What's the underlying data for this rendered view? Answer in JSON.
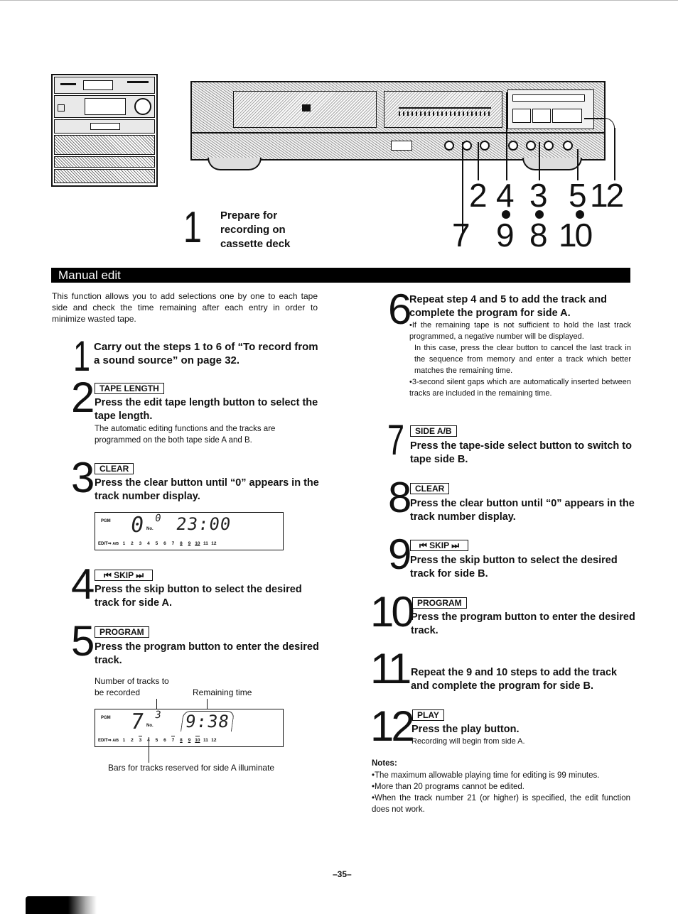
{
  "illustration": {
    "prepare_step": {
      "number": "1",
      "text": "Prepare for recording on cassette deck"
    },
    "callouts_top": [
      "2",
      "4",
      "3",
      "5",
      "12"
    ],
    "callouts_bottom": [
      "7",
      "9",
      "8",
      "10"
    ]
  },
  "section": {
    "title": "Manual edit"
  },
  "intro": "This function allows you to add selections one by one to each tape side and check the time remaining after each entry in order to minimize wasted tape.",
  "steps": [
    {
      "number": "1",
      "key": "",
      "heading": "Carry out the steps 1 to 6 of “To record from a sound source” on page 32.",
      "body": ""
    },
    {
      "number": "2",
      "key": "TAPE LENGTH",
      "heading": "Press the edit tape length button to select the tape length.",
      "body": "The automatic editing functions and the tracks are programmed on the both tape side A and B."
    },
    {
      "number": "3",
      "key": "CLEAR",
      "heading": "Press the clear button until “0” appears in the track number display.",
      "body": ""
    },
    {
      "number": "4",
      "key": "⏮ SKIP ⏭",
      "heading": "Press the skip button to select the desired track for side A.",
      "body": ""
    },
    {
      "number": "5",
      "key": "PROGRAM",
      "heading": "Press the program button to enter the desired track.",
      "body": ""
    },
    {
      "number": "6",
      "key": "",
      "heading": "Repeat step 4 and 5 to add the track and complete the program for side A.",
      "bullets": [
        "•If the remaining tape is not sufficient to hold the last track programmed, a negative number will be displayed.",
        "In this case, press the clear button to cancel the last track in the sequence from memory and enter a track which better matches the remaining time.",
        "•3-second silent gaps which are automatically inserted between tracks are included in the remaining time."
      ]
    },
    {
      "number": "7",
      "key": "SIDE A/B",
      "heading": "Press the tape-side select button to switch to tape side B.",
      "body": ""
    },
    {
      "number": "8",
      "key": "CLEAR",
      "heading": "Press the clear button until “0” appears in the track number display.",
      "body": ""
    },
    {
      "number": "9",
      "key": "⏮ SKIP ⏭",
      "heading": "Press the skip button to select the desired track for side B.",
      "body": ""
    },
    {
      "number": "10",
      "key": "PROGRAM",
      "heading": "Press the program button to enter the desired track.",
      "body": ""
    },
    {
      "number": "11",
      "key": "",
      "heading": "Repeat the 9 and 10 steps to add the track and complete the program for side B.",
      "body": ""
    },
    {
      "number": "12",
      "key": "PLAY",
      "heading": "Press the play button.",
      "body": "Recording will begin from side A."
    }
  ],
  "display_step3": {
    "pgm_label": "PGM",
    "program_count": "0",
    "no_label": "No.",
    "track_no": "0",
    "time": "23:00",
    "edit_label": "EDIT⇒",
    "side_label": "A/B",
    "tracks": [
      "1",
      "2",
      "3",
      "4",
      "5",
      "6",
      "7",
      "8",
      "9",
      "10",
      "11",
      "12"
    ],
    "underlined_tracks": [
      "8",
      "9",
      "10"
    ]
  },
  "display_step5": {
    "pgm_label": "PGM",
    "program_count": "7",
    "no_label": "No.",
    "track_no": "3",
    "time": "9:38",
    "edit_label": "EDIT⇒",
    "side_label": "A/B",
    "tracks": [
      "1",
      "2",
      "3",
      "4",
      "5",
      "6",
      "7",
      "8",
      "9",
      "10",
      "11",
      "12"
    ],
    "underlined_tracks": [
      "8",
      "9",
      "10"
    ],
    "overlined_tracks": [
      "3",
      "7",
      "10"
    ],
    "annotations": {
      "tracks_label": "Number of tracks to be recorded",
      "time_label": "Remaining time",
      "bars_label": "Bars for tracks reserved for side A illuminate"
    }
  },
  "notes": {
    "title": "Notes:",
    "items": [
      "•The maximum allowable playing time for editing is 99 minutes.",
      "•More than 20 programs cannot be edited.",
      "•When the track number 21 (or higher) is specified, the edit function does not work."
    ]
  },
  "page_number": "–35–"
}
